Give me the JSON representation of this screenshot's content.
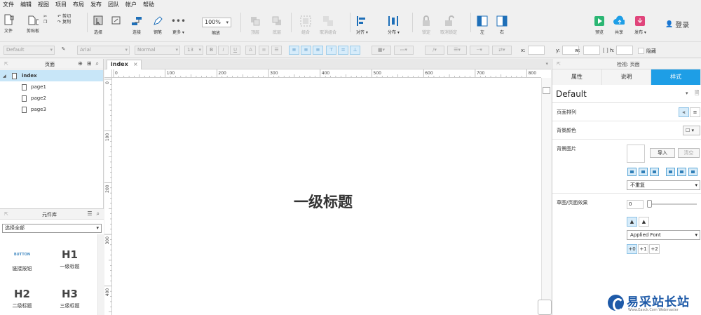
{
  "menu": [
    "文件",
    "编辑",
    "视图",
    "项目",
    "布局",
    "发布",
    "团队",
    "帐户",
    "帮助"
  ],
  "toolbar": {
    "file": "文件",
    "clipboard": "剪贴板",
    "cut": "剪切",
    "copy": "复制",
    "select": "选择",
    "connect": "连接",
    "pen": "钢笔",
    "more": "更多 ▾",
    "zoom_value": "100%",
    "zoom_label": "缩放",
    "top": "顶层",
    "bottom": "底层",
    "group": "组合",
    "ungroup": "取消组合",
    "align": "对齐 ▾",
    "distribute": "分布 ▾",
    "lock": "锁定",
    "unlock": "取消锁定",
    "left": "左",
    "right": "右",
    "preview": "预览",
    "share": "共享",
    "publish": "发布 ▾",
    "login": "登录",
    "colors": {
      "preview": "#2bb673",
      "share": "#1e9ee6",
      "publish": "#e0457b",
      "accent": "#1e9ee6"
    }
  },
  "format": {
    "style": "Default",
    "font": "Arial",
    "weight": "Normal",
    "size": "13",
    "x_label": "x:",
    "y_label": "y:",
    "w_label": "w:",
    "h_label": "h:",
    "hidden_label": "隐藏"
  },
  "pages_panel": {
    "title": "页面",
    "pages": [
      {
        "label": "index",
        "selected": true,
        "level": 0
      },
      {
        "label": "page1",
        "selected": false,
        "level": 1
      },
      {
        "label": "page2",
        "selected": false,
        "level": 1
      },
      {
        "label": "page3",
        "selected": false,
        "level": 1
      }
    ]
  },
  "library_panel": {
    "title": "元件库",
    "select_value": "选择全部",
    "widgets": [
      {
        "icon": "BUTTON",
        "label": "链接按钮"
      },
      {
        "icon": "H1",
        "label": "一级标题"
      },
      {
        "icon": "H2",
        "label": "二级标题"
      },
      {
        "icon": "H3",
        "label": "三级标题"
      }
    ]
  },
  "canvas": {
    "tab": "index",
    "tab_close": "×",
    "heading": "一级标题",
    "hruler": [
      "0",
      "100",
      "200",
      "300",
      "400",
      "500",
      "600",
      "700",
      "800"
    ],
    "vruler": [
      "0",
      "100",
      "200",
      "300",
      "400"
    ]
  },
  "inspector": {
    "title": "检视: 页面",
    "tabs": [
      "属性",
      "说明",
      "样式"
    ],
    "active_tab": 2,
    "style_name": "Default",
    "page_align": "页面排列",
    "bg_color": "背景颜色",
    "bg_image": "背景图片",
    "import": "导入",
    "clear": "清空",
    "repeat_value": "不重复",
    "sketch": "草图/页面效果",
    "sketch_value": "0",
    "font_value": "Applied Font",
    "font_steps": [
      "+0",
      "+1",
      "+2"
    ]
  },
  "watermark": {
    "title": "易采站长站",
    "sub": "Www.Easck.Com Webmaster"
  }
}
